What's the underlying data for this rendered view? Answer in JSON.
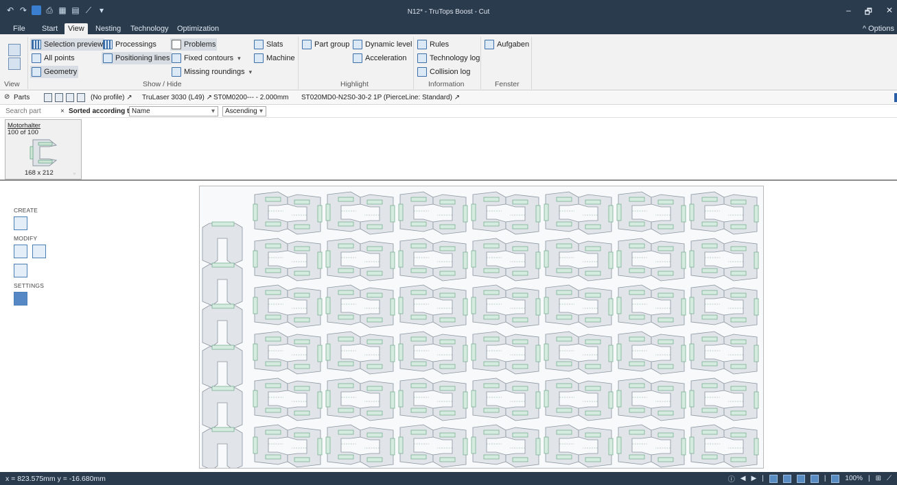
{
  "window": {
    "title": "N12* - TruTops Boost - Cut",
    "minimize": "–",
    "restore": "🗗",
    "close": "✕"
  },
  "quick_access": [
    "undo-icon",
    "redo-icon",
    "save-icon",
    "print-icon",
    "grid-icon",
    "layout-icon",
    "measure-icon",
    "customize-icon"
  ],
  "menu": {
    "tabs": [
      {
        "label": "File"
      },
      {
        "label": "Start"
      },
      {
        "label": "View"
      },
      {
        "label": "Nesting"
      },
      {
        "label": "Technology"
      },
      {
        "label": "Optimization"
      }
    ],
    "active_tab": "View",
    "options_label": "Options"
  },
  "ribbon": {
    "view_group": {
      "label": "View"
    },
    "show_hide": {
      "label": "Show / Hide",
      "selection_preview": "Selection preview",
      "processings": "Processings",
      "problems": "Problems",
      "slats": "Slats",
      "all_points": "All points",
      "positioning_lines": "Positioning lines",
      "fixed_contours": "Fixed contours",
      "machine": "Machine",
      "geometry": "Geometry",
      "missing_roundings": "Missing roundings"
    },
    "highlight": {
      "label": "Highlight",
      "part_group": "Part group",
      "dynamic_level": "Dynamic level",
      "acceleration": "Acceleration"
    },
    "information": {
      "label": "Information",
      "rules": "Rules",
      "technology_log": "Technology log",
      "collision_log": "Collision log"
    },
    "fenster": {
      "label": "Fenster",
      "aufgaben": "Aufgaben"
    }
  },
  "parts_bar": {
    "parts_label": "Parts",
    "profile": "(No profile) ↗",
    "machine": "TruLaser 3030 (L49) ↗",
    "material": "ST0M0200--- - 2.000mm",
    "technology": "ST020MD0-N2S0-30-2 1P (PierceLine: Standard) ↗"
  },
  "search": {
    "placeholder": "Search part",
    "clear": "×",
    "sorted_label": "Sorted according to:",
    "sort_field": "Name",
    "sort_order": "Ascending"
  },
  "parts": [
    {
      "name": "Motorhalter",
      "count": "100 of 100",
      "dims": "168 x 212"
    }
  ],
  "left_panel": {
    "create": "CREATE",
    "modify": "MODIFY",
    "settings": "SETTINGS"
  },
  "status": {
    "coords": "x = 823.575mm y = -16.680mm",
    "zoom": "100%"
  }
}
